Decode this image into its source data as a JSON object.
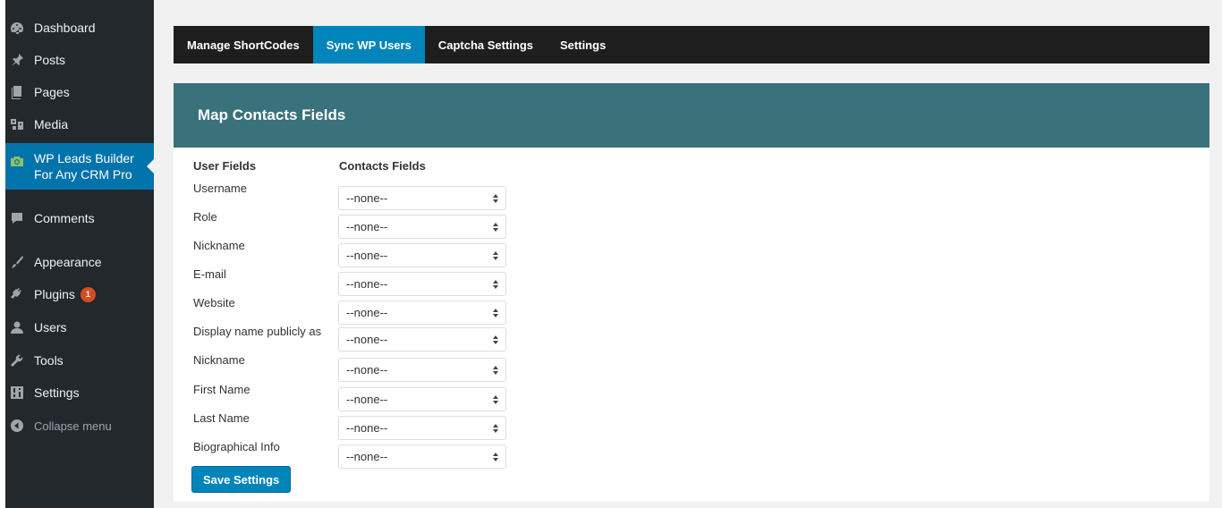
{
  "sidebar": {
    "items": [
      {
        "label": "Dashboard",
        "icon": "dashboard-icon"
      },
      {
        "label": "Posts",
        "icon": "pin-icon"
      },
      {
        "label": "Pages",
        "icon": "pages-icon"
      },
      {
        "label": "Media",
        "icon": "media-icon"
      },
      {
        "label": "WP Leads Builder For Any CRM Pro",
        "icon": "camera-icon",
        "current": true
      },
      {
        "label": "Comments",
        "icon": "comment-icon"
      },
      {
        "label": "Appearance",
        "icon": "brush-icon"
      },
      {
        "label": "Plugins",
        "icon": "plugin-icon",
        "badge": "1"
      },
      {
        "label": "Users",
        "icon": "user-icon"
      },
      {
        "label": "Tools",
        "icon": "wrench-icon"
      },
      {
        "label": "Settings",
        "icon": "sliders-icon"
      },
      {
        "label": "Collapse menu",
        "icon": "collapse-icon"
      }
    ]
  },
  "tabs": [
    {
      "label": "Manage ShortCodes",
      "active": false
    },
    {
      "label": "Sync WP Users",
      "active": true
    },
    {
      "label": "Captcha Settings",
      "active": false
    },
    {
      "label": "Settings",
      "active": false
    }
  ],
  "panel": {
    "title": "Map Contacts Fields",
    "col_user": "User Fields",
    "col_contacts": "Contacts Fields",
    "rows": [
      {
        "label": "Username",
        "value": "--none--"
      },
      {
        "label": "Role",
        "value": "--none--"
      },
      {
        "label": "Nickname",
        "value": "--none--"
      },
      {
        "label": "E-mail",
        "value": "--none--"
      },
      {
        "label": "Website",
        "value": "--none--"
      },
      {
        "label": "Display name publicly as",
        "value": "--none--"
      },
      {
        "label": "Nickname",
        "value": "--none--"
      },
      {
        "label": "First Name",
        "value": "--none--"
      },
      {
        "label": "Last Name",
        "value": "--none--"
      },
      {
        "label": "Biographical Info",
        "value": "--none--"
      }
    ],
    "save_label": "Save Settings"
  },
  "colors": {
    "sidebar": "#23282d",
    "accent": "#0073aa",
    "tab_active": "#0085ba",
    "panel_header": "#3a727c",
    "badge": "#d54e21"
  }
}
